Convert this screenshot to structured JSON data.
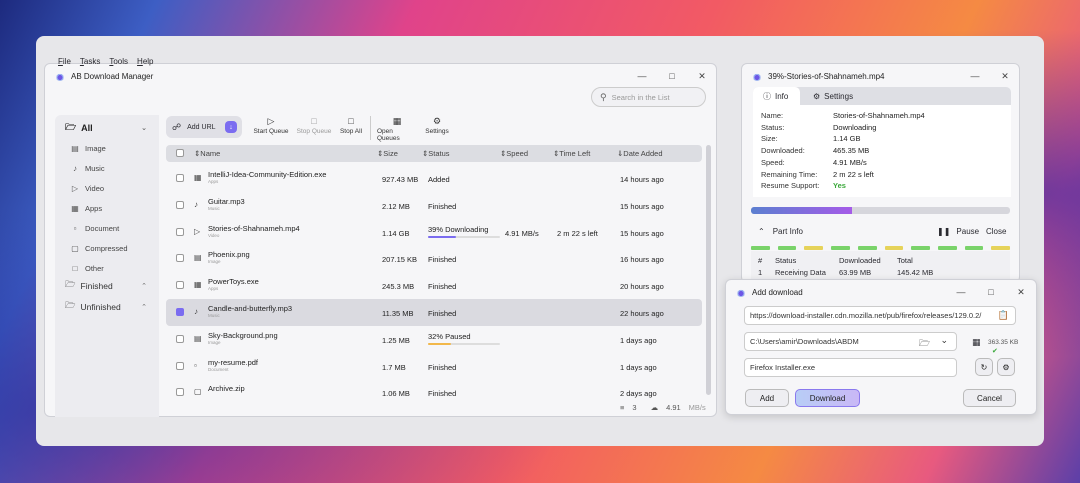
{
  "main": {
    "title": "AB Download Manager",
    "menu": [
      "File",
      "Tasks",
      "Tools",
      "Help"
    ],
    "search_placeholder": "Search in the List",
    "categories": {
      "all": "All",
      "items": [
        "Image",
        "Music",
        "Video",
        "Apps",
        "Document",
        "Compressed",
        "Other"
      ],
      "finished": "Finished",
      "unfinished": "Unfinished"
    },
    "toolbar": {
      "add_url": "Add URL",
      "start": "Start Queue",
      "stop_queue": "Stop Queue",
      "stop_all": "Stop All",
      "open_queues": "Open Queues",
      "settings": "Settings"
    },
    "columns": {
      "name": "Name",
      "size": "Size",
      "status": "Status",
      "speed": "Speed",
      "time": "Time Left",
      "date": "Date Added"
    },
    "rows": [
      {
        "name": "IntelliJ-Idea-Community-Edition.exe",
        "type": "Apps",
        "size": "927.43 MB",
        "status": "Added",
        "speed": "",
        "time": "",
        "date": "14 hours ago"
      },
      {
        "name": "Guitar.mp3",
        "type": "Music",
        "size": "2.12 MB",
        "status": "Finished",
        "speed": "",
        "time": "",
        "date": "15 hours ago"
      },
      {
        "name": "Stories-of-Shahnameh.mp4",
        "type": "Video",
        "size": "1.14 GB",
        "status": "39% Downloading",
        "speed": "4.91 MB/s",
        "time": "2 m 22 s left",
        "date": "15 hours ago",
        "progress": 39
      },
      {
        "name": "Phoenix.png",
        "type": "Image",
        "size": "207.15 KB",
        "status": "Finished",
        "speed": "",
        "time": "",
        "date": "16 hours ago"
      },
      {
        "name": "PowerToys.exe",
        "type": "Apps",
        "size": "245.3 MB",
        "status": "Finished",
        "speed": "",
        "time": "",
        "date": "20 hours ago"
      },
      {
        "name": "Candle-and-butterfly.mp3",
        "type": "Music",
        "size": "11.35 MB",
        "status": "Finished",
        "speed": "",
        "time": "",
        "date": "22 hours ago"
      },
      {
        "name": "Sky-Background.png",
        "type": "Image",
        "size": "1.25 MB",
        "status": "32% Paused",
        "speed": "",
        "time": "",
        "date": "1 days ago",
        "progress": 32
      },
      {
        "name": "my-resume.pdf",
        "type": "Document",
        "size": "1.7 MB",
        "status": "Finished",
        "speed": "",
        "time": "",
        "date": "1 days ago"
      },
      {
        "name": "Archive.zip",
        "type": "",
        "size": "1.06 MB",
        "status": "Finished",
        "speed": "",
        "time": "",
        "date": "2 days ago"
      }
    ],
    "footer": {
      "active": "3",
      "speed": "4.91",
      "unit": "MB/s"
    }
  },
  "progress": {
    "title": "39%-Stories-of-Shahnameh.mp4",
    "tab_info": "Info",
    "tab_settings": "Settings",
    "fields": [
      [
        "Name:",
        "Stories-of-Shahnameh.mp4"
      ],
      [
        "Status:",
        "Downloading"
      ],
      [
        "Size:",
        "1.14 GB"
      ],
      [
        "Downloaded:",
        "465.35 MB"
      ],
      [
        "Speed:",
        "4.91 MB/s"
      ],
      [
        "Remaining Time:",
        "2 m 22 s left"
      ],
      [
        "Resume Support:",
        "Yes"
      ]
    ],
    "percent": 39,
    "part_info": "Part Info",
    "pause": "Pause",
    "close": "Close",
    "part_cols": [
      "#",
      "Status",
      "Downloaded",
      "Total"
    ],
    "part_row": [
      "1",
      "Receiving Data",
      "63.99 MB",
      "145.42 MB"
    ]
  },
  "add": {
    "title": "Add download",
    "url": "https://download-installer.cdn.mozilla.net/pub/firefox/releases/129.0.2/",
    "folder": "C:\\Users\\amir\\Downloads\\ABDM",
    "size": "363.35 KB",
    "filename": "Firefox Installer.exe",
    "add": "Add",
    "download": "Download",
    "cancel": "Cancel"
  },
  "colors": {
    "accent": "#7b6cf0",
    "green": "#3aa83a"
  }
}
